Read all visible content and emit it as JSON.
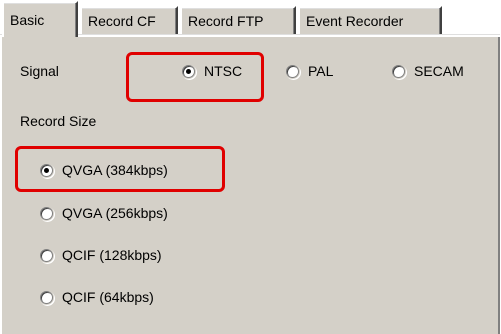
{
  "tabs": [
    {
      "label": "Basic",
      "active": true
    },
    {
      "label": "Record CF",
      "active": false
    },
    {
      "label": "Record FTP",
      "active": false
    },
    {
      "label": "Event Recorder",
      "active": false
    }
  ],
  "signal": {
    "label": "Signal",
    "options": [
      {
        "label": "NTSC",
        "selected": true
      },
      {
        "label": "PAL",
        "selected": false
      },
      {
        "label": "SECAM",
        "selected": false
      }
    ]
  },
  "record_size": {
    "label": "Record Size",
    "options": [
      {
        "label": "QVGA (384kbps)",
        "selected": true
      },
      {
        "label": "QVGA (256kbps)",
        "selected": false
      },
      {
        "label": "QCIF (128kbps)",
        "selected": false
      },
      {
        "label": "QCIF (64kbps)",
        "selected": false
      }
    ]
  },
  "colors": {
    "panel_background": "#d4d0c8",
    "highlight": "#e00000"
  }
}
